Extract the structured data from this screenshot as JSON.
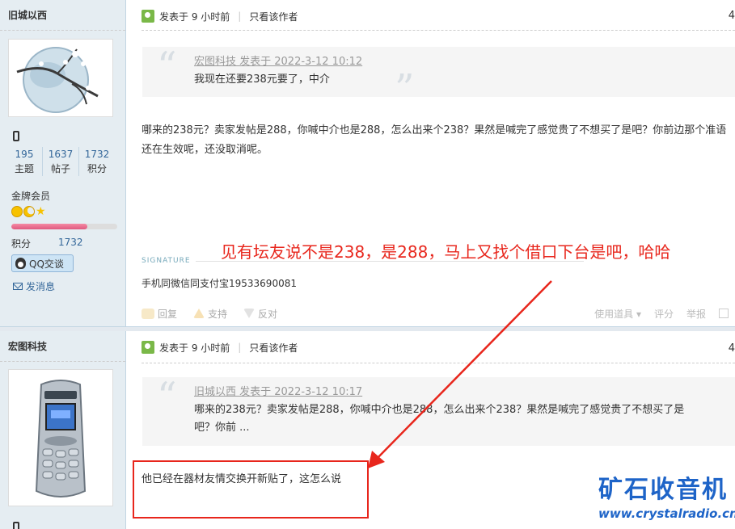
{
  "post1": {
    "author": "旧城以西",
    "stats": [
      {
        "value": "195",
        "label": "主题"
      },
      {
        "value": "1637",
        "label": "帖子"
      },
      {
        "value": "1732",
        "label": "积分"
      }
    ],
    "group": "金牌会员",
    "points_label": "积分",
    "points_value": "1732",
    "level_progress": 0.72,
    "qq_label": "QQ交谈",
    "message_label": "发消息",
    "posted": "发表于 9 小时前",
    "only_author": "只看该作者",
    "floor": "4",
    "quote_who": "宏图科技 发表于 2022-3-12 10:12",
    "quote_text": "我现在还要238元要了，中介",
    "content": "哪来的238元？卖家发帖是288，你喊中介也是288，怎么出来个238？果然是喊完了感觉贵了不想买了是吧？你前边那个准语还在生效呢，还没取消呢。",
    "signature_label": "SIGNATURE",
    "signature": "手机同微信同支付宝19533690081",
    "actions": [
      "回复",
      "支持",
      "反对"
    ],
    "actions_right": [
      "使用道具",
      "评分",
      "举报"
    ]
  },
  "post2": {
    "author": "宏图科技",
    "posted": "发表于 9 小时前",
    "only_author": "只看该作者",
    "floor": "4",
    "quote_who": "旧城以西 发表于 2022-3-12 10:17",
    "quote_text": "哪来的238元？卖家发帖是288，你喊中介也是288，怎么出来个238？果然是喊完了感觉贵了不想买了是吧？你前 ...",
    "content": "他已经在器材友情交换开新贴了，这怎么说"
  },
  "annotation": "见有坛友说不是238，是288，马上又找个借口下台是吧，哈哈",
  "watermark": {
    "title": "矿石收音机",
    "url": "www.crystalradio.cn"
  },
  "colors": {
    "accent_red": "#e8261c",
    "link_blue": "#336699",
    "sidebar_bg": "#e5edf2",
    "watermark_blue": "#1e64c8"
  }
}
